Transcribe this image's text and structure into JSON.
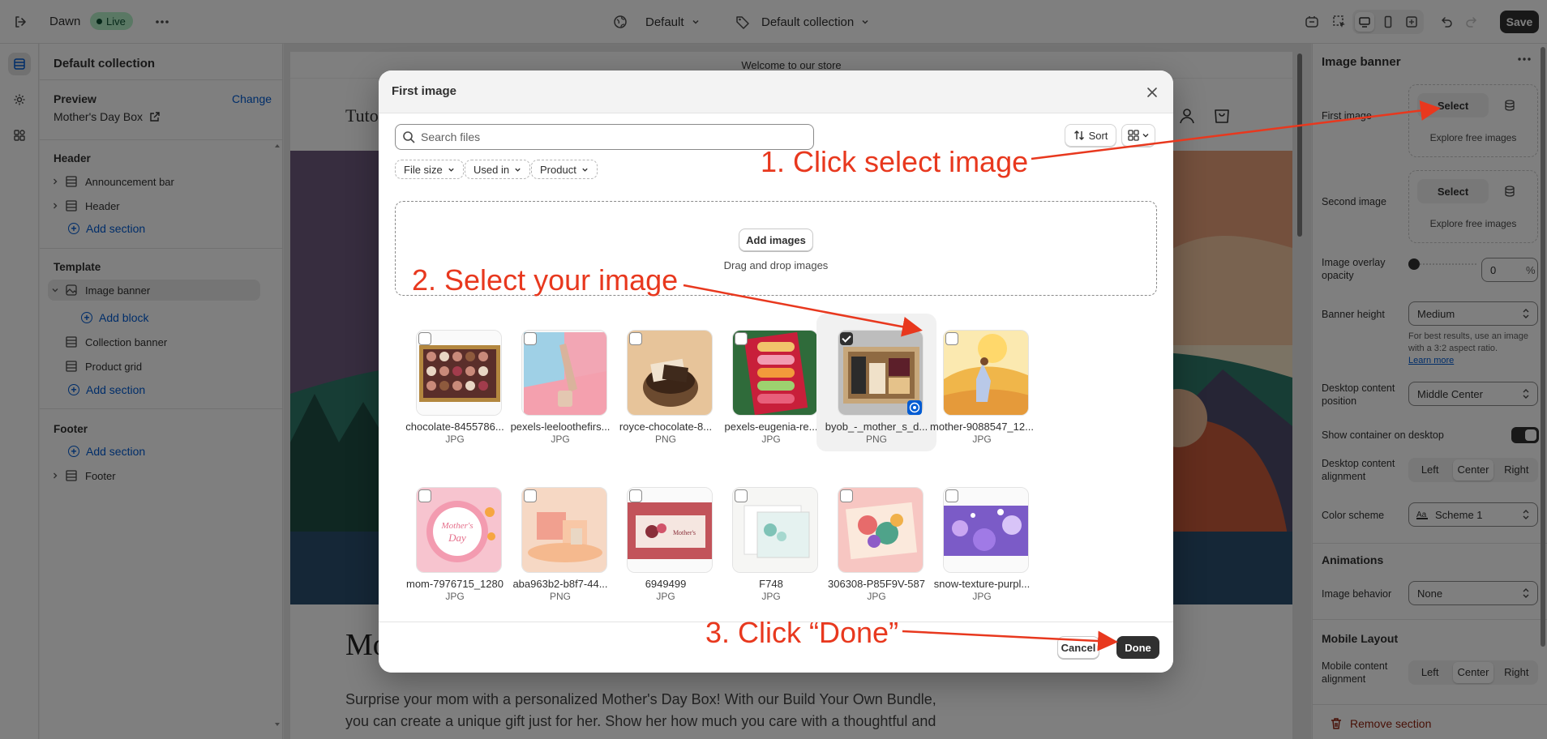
{
  "topbar": {
    "theme_name": "Dawn",
    "live_badge": "Live",
    "page_select": "Default",
    "template_select": "Default collection",
    "save_label": "Save"
  },
  "sidebar": {
    "title": "Default collection",
    "preview_label": "Preview",
    "change_label": "Change",
    "preview_item": "Mother's Day Box",
    "header_group": {
      "title": "Header",
      "items": [
        "Announcement bar",
        "Header"
      ],
      "add_label": "Add section"
    },
    "template_group": {
      "title": "Template",
      "selected": "Image banner",
      "add_block": "Add block",
      "items": [
        "Collection banner",
        "Product grid"
      ],
      "add_label": "Add section"
    },
    "footer_group": {
      "title": "Footer",
      "add_label": "Add section",
      "items": [
        "Footer"
      ]
    }
  },
  "preview": {
    "announcement": "Welcome to our store",
    "logo_text": "Tuto",
    "heading": "Mo",
    "description": "Surprise your mom with a personalized Mother's Day Box! With our Build Your Own Bundle, you can create a unique gift just for her. Show her how much you care with a thoughtful and"
  },
  "settings": {
    "title": "Image banner",
    "first_image": {
      "label": "First image",
      "select": "Select",
      "explore": "Explore free images"
    },
    "second_image": {
      "label": "Second image",
      "select": "Select",
      "explore": "Explore free images"
    },
    "overlay": {
      "label": "Image overlay opacity",
      "value": "0",
      "unit": "%",
      "level": 0
    },
    "banner_height": {
      "label": "Banner height",
      "value": "Medium",
      "help": "For best results, use an image with a 3:2 aspect ratio.",
      "help_link": "Learn more"
    },
    "content_position": {
      "label": "Desktop content position",
      "value": "Middle Center"
    },
    "show_container": {
      "label": "Show container on desktop",
      "on": true
    },
    "content_alignment": {
      "label": "Desktop content alignment",
      "options": [
        "Left",
        "Center",
        "Right"
      ],
      "selected": "Center"
    },
    "color_scheme": {
      "label": "Color scheme",
      "value": "Scheme 1"
    },
    "animations": {
      "title": "Animations",
      "behavior_label": "Image behavior",
      "behavior_value": "None"
    },
    "mobile": {
      "title": "Mobile Layout",
      "alignment_label": "Mobile content alignment",
      "options": [
        "Left",
        "Center",
        "Right"
      ],
      "selected": "Center"
    },
    "remove_label": "Remove section"
  },
  "modal": {
    "title": "First image",
    "search_placeholder": "Search files",
    "sort_label": "Sort",
    "filters": [
      "File size",
      "Used in",
      "Product"
    ],
    "add_images": "Add images",
    "drag_drop": "Drag and drop images",
    "files": [
      {
        "name": "chocolate-8455786...",
        "type": "JPG",
        "checked": false
      },
      {
        "name": "pexels-leeloothefirs...",
        "type": "JPG",
        "checked": false
      },
      {
        "name": "royce-chocolate-8...",
        "type": "PNG",
        "checked": false
      },
      {
        "name": "pexels-eugenia-re...",
        "type": "JPG",
        "checked": false
      },
      {
        "name": "byob_-_mother_s_d...",
        "type": "PNG",
        "checked": true
      },
      {
        "name": "mother-9088547_12...",
        "type": "JPG",
        "checked": false
      },
      {
        "name": "mom-7976715_1280",
        "type": "JPG",
        "checked": false
      },
      {
        "name": "aba963b2-b8f7-44...",
        "type": "PNG",
        "checked": false
      },
      {
        "name": "6949499",
        "type": "JPG",
        "checked": false
      },
      {
        "name": "F748",
        "type": "JPG",
        "checked": false
      },
      {
        "name": "306308-P85F9V-587",
        "type": "JPG",
        "checked": false
      },
      {
        "name": "snow-texture-purpl...",
        "type": "JPG",
        "checked": false
      }
    ],
    "cancel_label": "Cancel",
    "done_label": "Done"
  },
  "annotations": {
    "step1": "1. Click select image",
    "step2": "2. Select your image",
    "step3": "3. Click “Done”",
    "color": "#e8381e"
  },
  "colors": {
    "accent_link": "#005bd3",
    "primary_button": "#303030",
    "live_badge_bg": "#b4f0c8"
  }
}
